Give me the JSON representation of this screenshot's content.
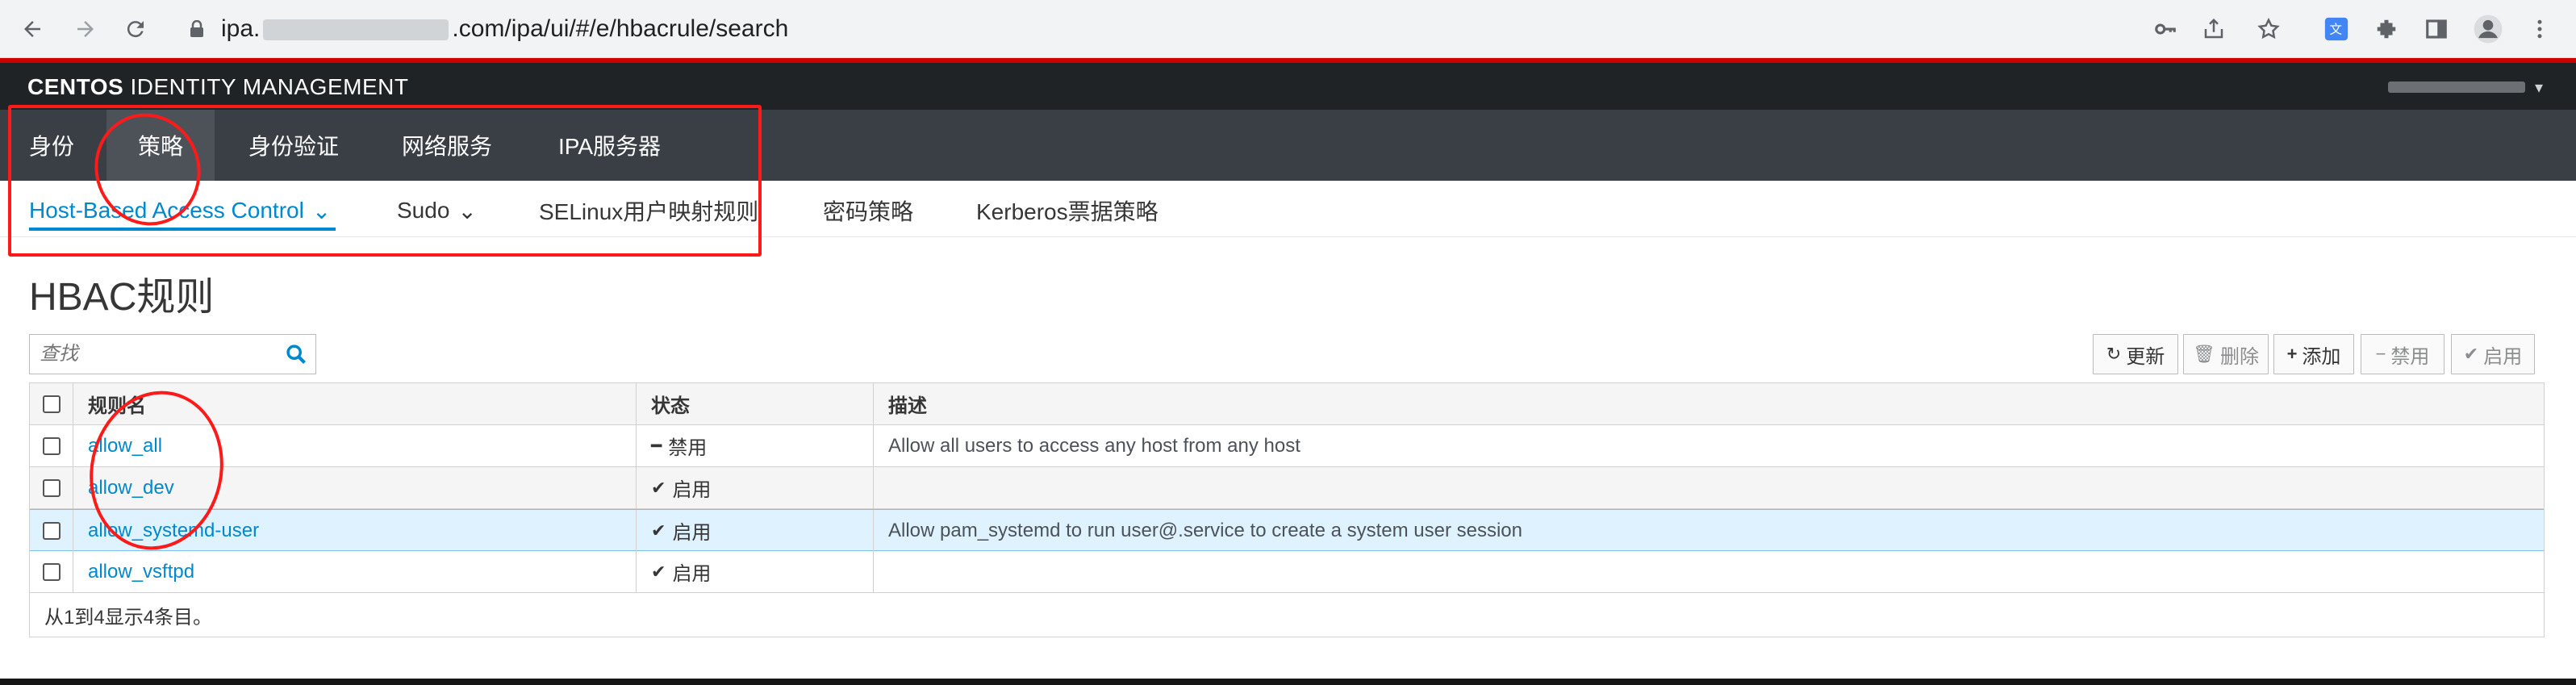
{
  "browser": {
    "url_prefix": "ipa.",
    "url_suffix": ".com/ipa/ui/#/e/hbacrule/search"
  },
  "header": {
    "brand_bold": "CENTOS",
    "brand_rest": " IDENTITY MANAGEMENT"
  },
  "primary_nav": {
    "items": [
      {
        "label": "身份"
      },
      {
        "label": "策略"
      },
      {
        "label": "身份验证"
      },
      {
        "label": "网络服务"
      },
      {
        "label": "IPA服务器"
      }
    ]
  },
  "secondary_nav": {
    "items": [
      {
        "label": "Host-Based Access Control",
        "caret": "⌄"
      },
      {
        "label": "Sudo",
        "caret": "⌄"
      },
      {
        "label": "SELinux用户映射规则"
      },
      {
        "label": "密码策略"
      },
      {
        "label": "Kerberos票据策略"
      }
    ]
  },
  "page": {
    "title": "HBAC规则",
    "search_placeholder": "查找"
  },
  "toolbar": {
    "refresh": {
      "icon": "↻",
      "label": "更新"
    },
    "delete": {
      "icon": "🗑",
      "label": "删除"
    },
    "add": {
      "icon": "+",
      "label": "添加"
    },
    "disable": {
      "icon": "−",
      "label": "禁用"
    },
    "enable": {
      "icon": "✔",
      "label": "启用"
    }
  },
  "table": {
    "headers": {
      "name": "规则名",
      "status": "状态",
      "description": "描述"
    },
    "rows": [
      {
        "name": "allow_all",
        "status_icon": "━",
        "status": "禁用",
        "description": "Allow all users to access any host from any host"
      },
      {
        "name": "allow_dev",
        "status_icon": "✔",
        "status": "启用",
        "description": ""
      },
      {
        "name": "allow_systemd-user",
        "status_icon": "✔",
        "status": "启用",
        "description": "Allow pam_systemd to run user@.service to create a system user session"
      },
      {
        "name": "allow_vsftpd",
        "status_icon": "✔",
        "status": "启用",
        "description": ""
      }
    ],
    "footer": "从1到4显示4条目。"
  },
  "colors": {
    "accent": "#0088ce",
    "nav_dark": "#393f44",
    "header_dark": "#202326",
    "annotation_red": "#ff1a1a"
  }
}
